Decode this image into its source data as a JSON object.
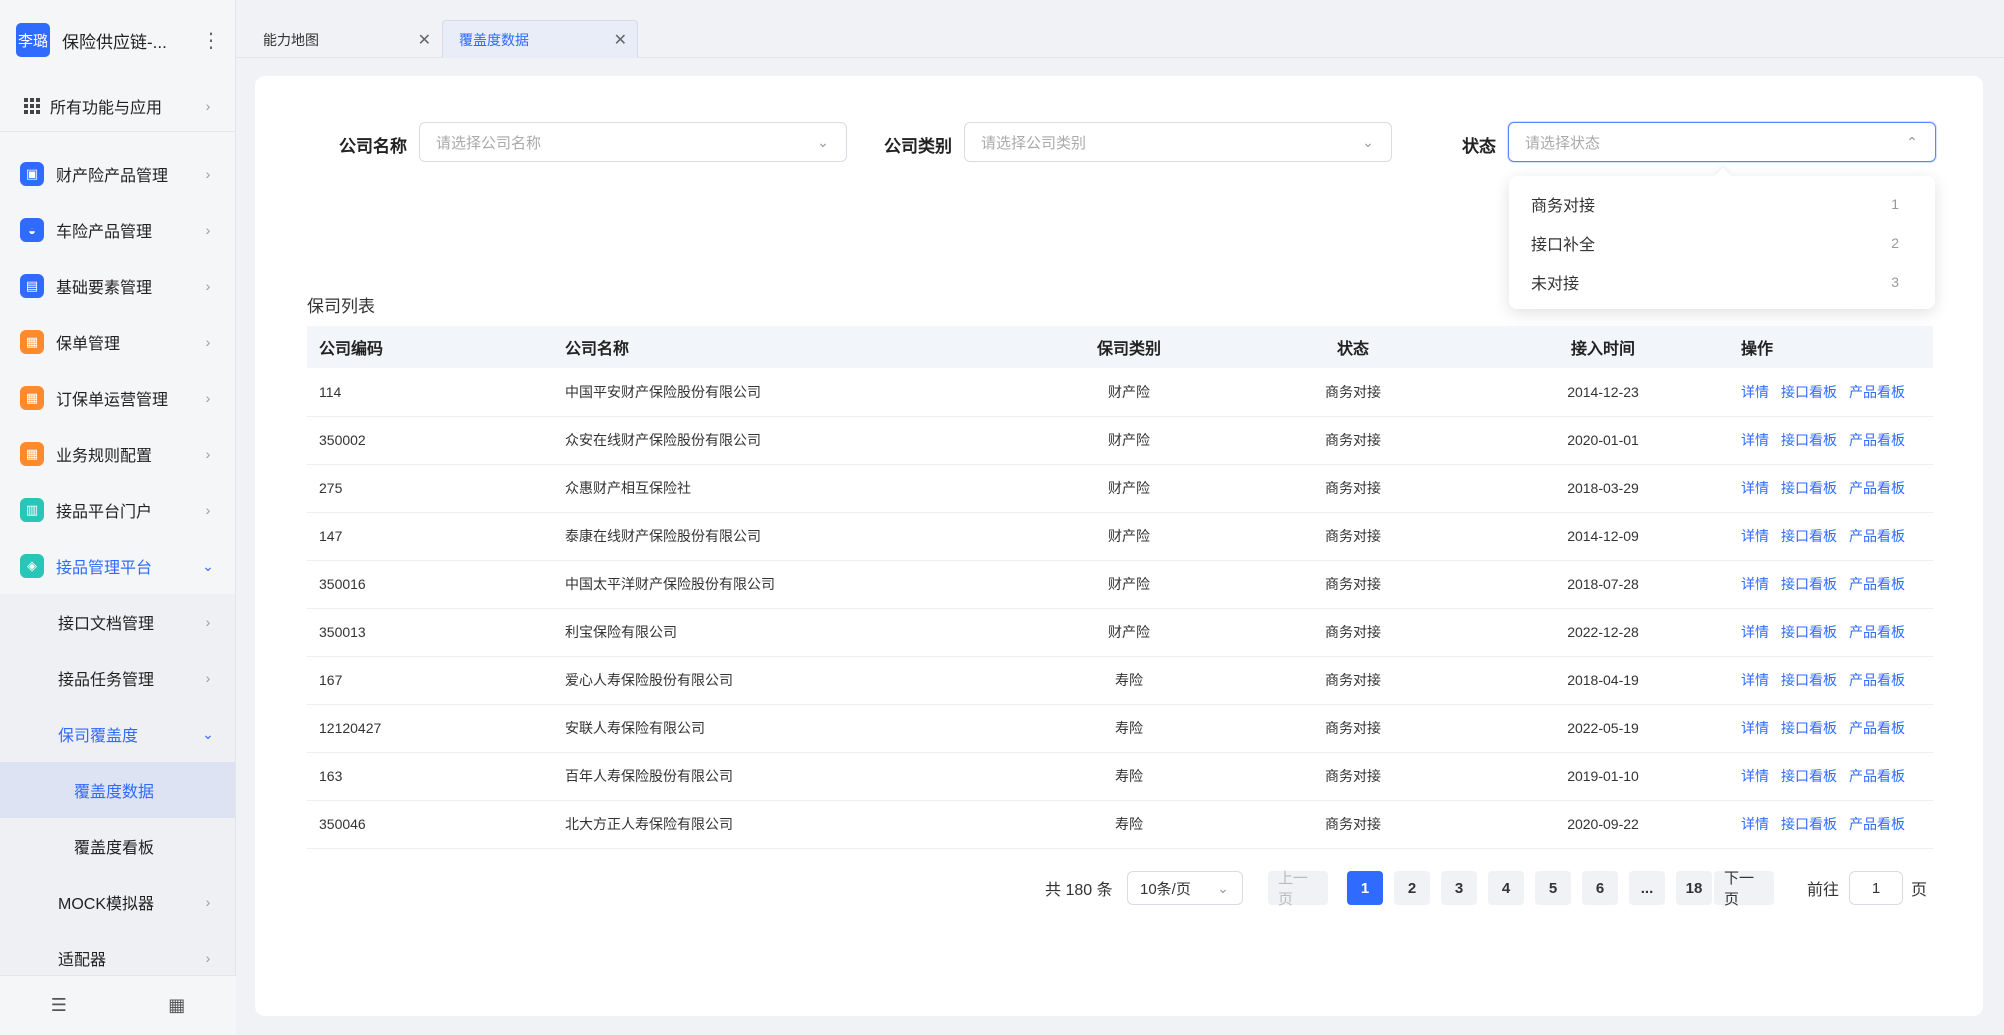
{
  "sidebar": {
    "avatar_text": "李璐",
    "app_name": "保险供应链-...",
    "more_icon": "more-vertical-icon",
    "all_apps": "所有功能与应用",
    "menu": [
      {
        "label": "财产险产品管理",
        "icon": "wallet-icon",
        "color": "#2f6bff",
        "glyph": "▣"
      },
      {
        "label": "车险产品管理",
        "icon": "car-icon",
        "color": "#2f6bff",
        "glyph": "◒"
      },
      {
        "label": "基础要素管理",
        "icon": "terminal-icon",
        "color": "#2f6bff",
        "glyph": "▤"
      },
      {
        "label": "保单管理",
        "icon": "policy-icon",
        "color": "#ff8a2b",
        "glyph": "▦"
      },
      {
        "label": "订保单运营管理",
        "icon": "order-icon",
        "color": "#ff8a2b",
        "glyph": "▦"
      },
      {
        "label": "业务规则配置",
        "icon": "rule-icon",
        "color": "#ff8a2b",
        "glyph": "▦"
      },
      {
        "label": "接品平台门户",
        "icon": "portal-icon",
        "color": "#29c5b6",
        "glyph": "▥"
      },
      {
        "label": "接品管理平台",
        "icon": "cube-icon",
        "color": "#29c5b6",
        "glyph": "◈"
      }
    ],
    "sub_items": {
      "doc": "接口文档管理",
      "task": "接品任务管理",
      "coverage": "保司覆盖度",
      "coverage_data": "覆盖度数据",
      "coverage_board": "覆盖度看板",
      "mock": "MOCK模拟器",
      "adapter": "适配器"
    }
  },
  "tabs": [
    {
      "label": "能力地图",
      "active": false
    },
    {
      "label": "覆盖度数据",
      "active": true
    }
  ],
  "filters": {
    "company_name": {
      "label": "公司名称",
      "placeholder": "请选择公司名称"
    },
    "company_type": {
      "label": "公司类别",
      "placeholder": "请选择公司类别"
    },
    "status": {
      "label": "状态",
      "placeholder": "请选择状态"
    }
  },
  "status_dropdown": [
    {
      "label": "商务对接",
      "count": "1"
    },
    {
      "label": "接口补全",
      "count": "2"
    },
    {
      "label": "未对接",
      "count": "3"
    }
  ],
  "list_title": "保司列表",
  "table": {
    "headers": [
      "公司编码",
      "公司名称",
      "保司类别",
      "状态",
      "接入时间",
      "操作"
    ],
    "actions": [
      "详情",
      "接口看板",
      "产品看板"
    ],
    "rows": [
      [
        "114",
        "中国平安财产保险股份有限公司",
        "财产险",
        "商务对接",
        "2014-12-23"
      ],
      [
        "350002",
        "众安在线财产保险股份有限公司",
        "财产险",
        "商务对接",
        "2020-01-01"
      ],
      [
        "275",
        "众惠财产相互保险社",
        "财产险",
        "商务对接",
        "2018-03-29"
      ],
      [
        "147",
        "泰康在线财产保险股份有限公司",
        "财产险",
        "商务对接",
        "2014-12-09"
      ],
      [
        "350016",
        "中国太平洋财产保险股份有限公司",
        "财产险",
        "商务对接",
        "2018-07-28"
      ],
      [
        "350013",
        "利宝保险有限公司",
        "财产险",
        "商务对接",
        "2022-12-28"
      ],
      [
        "167",
        "爱心人寿保险股份有限公司",
        "寿险",
        "商务对接",
        "2018-04-19"
      ],
      [
        "12120427",
        "安联人寿保险有限公司",
        "寿险",
        "商务对接",
        "2022-05-19"
      ],
      [
        "163",
        "百年人寿保险股份有限公司",
        "寿险",
        "商务对接",
        "2019-01-10"
      ],
      [
        "350046",
        "北大方正人寿保险有限公司",
        "寿险",
        "商务对接",
        "2020-09-22"
      ]
    ]
  },
  "pagination": {
    "total": "共 180 条",
    "page_size": "10条/页",
    "prev": "上一页",
    "next": "下一页",
    "pages": [
      "1",
      "2",
      "3",
      "4",
      "5",
      "6",
      "...",
      "18"
    ],
    "current": "1",
    "goto_prefix": "前往",
    "goto_value": "1",
    "goto_suffix": "页"
  },
  "colors": {
    "accent": "#2f6bff"
  }
}
